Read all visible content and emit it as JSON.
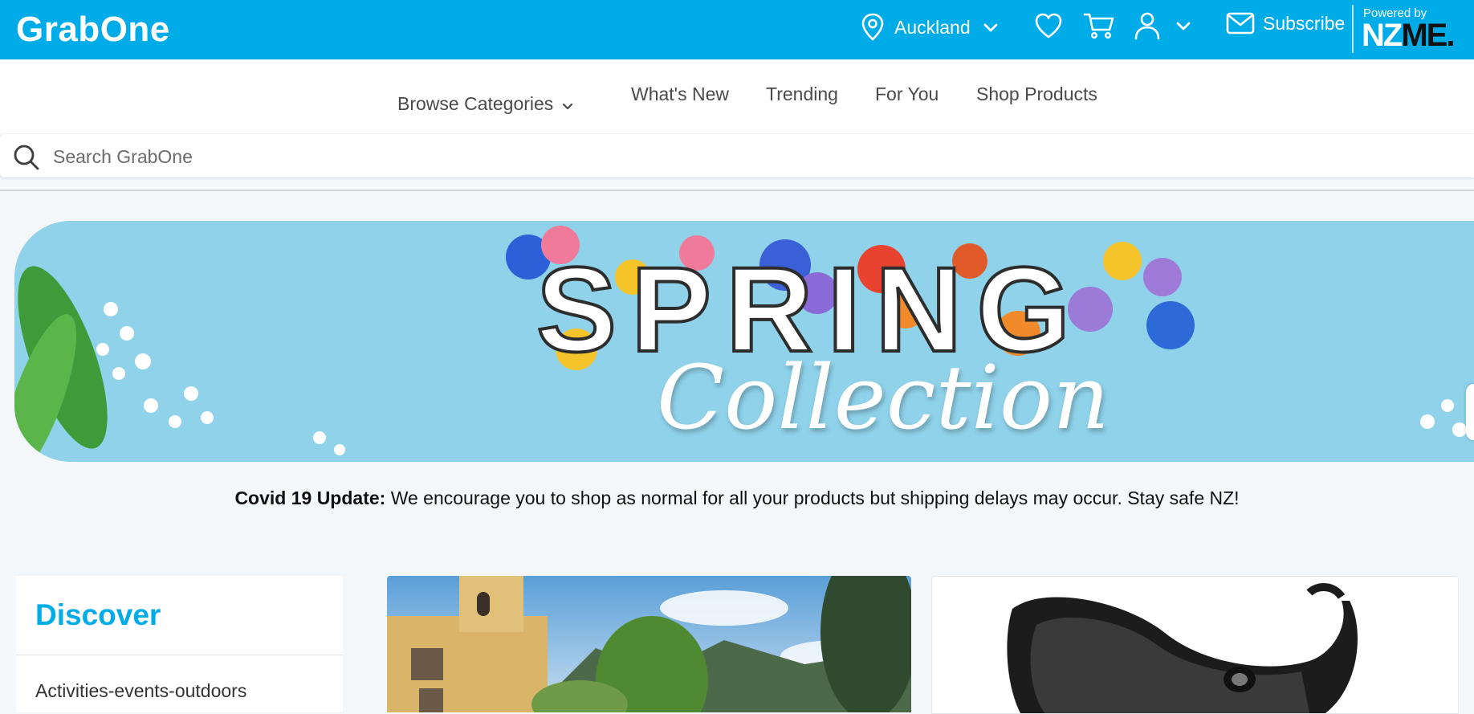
{
  "header": {
    "logo": "GrabOne",
    "location": "Auckland",
    "subscribe_label": "Subscribe",
    "powered_by": "Powered by",
    "nzme_part1": "NZ",
    "nzme_part2": "ME."
  },
  "nav": {
    "browse_label": "Browse Categories",
    "items": [
      "What's New",
      "Trending",
      "For You",
      "Shop Products"
    ]
  },
  "search": {
    "placeholder": "Search GrabOne"
  },
  "banner": {
    "line1": "SPRING",
    "line2": "Collection"
  },
  "notice": {
    "bold": "Covid 19 Update:",
    "text": " We encourage you to shop as normal for all your products but shipping delays may occur. Stay safe NZ!"
  },
  "discover": {
    "title": "Discover",
    "first_category": "Activities-events-outdoors"
  },
  "colors": {
    "brand": "#00ace8",
    "banner_bg": "#8fd2ea"
  }
}
